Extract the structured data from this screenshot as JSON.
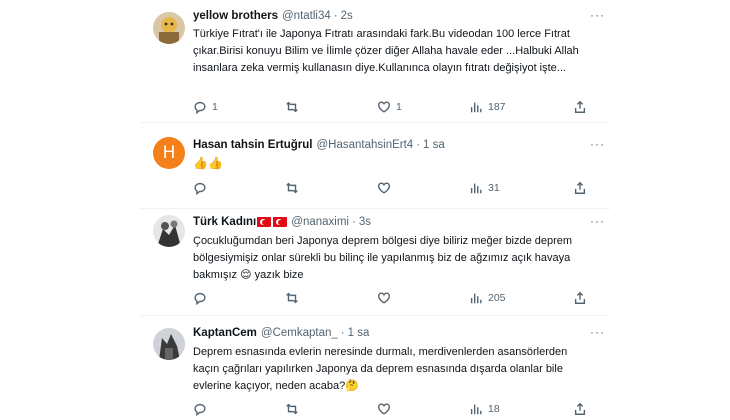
{
  "tweets": [
    {
      "name": "yellow brothers",
      "handle": "@ntatli34",
      "time": "2s",
      "text": "Türkiye Fıtrat'ı ile Japonya Fıtratı arasındaki fark.Bu videodan 100 lerce Fıtrat çıkar.Birisi konuyu Bilim ve İlimle çözer diğer Allaha havale eder ...Halbuki Allah insanlara zeka vermiş kullanasın diye.Kullanınca olayın fıtratı değişiyot işte...",
      "replies": "1",
      "retweets": "",
      "likes": "1",
      "views": "187"
    },
    {
      "name": "Hasan tahsin Ertuğrul",
      "handle": "@HasantahsinErt4",
      "time": "1 sa",
      "avatar_letter": "H",
      "text": "👍👍",
      "replies": "",
      "retweets": "",
      "likes": "",
      "views": "31"
    },
    {
      "name": "Türk Kadını",
      "handle": "@nanaximi",
      "time": "3s",
      "text": "Çocukluğumdan beri Japonya deprem bölgesi diye biliriz meğer bizde deprem bölgesiymişiz onlar sürekli bu bilinç ile yapılanmış biz de ağzımız açık havaya bakmışız 😌 yazık bize",
      "replies": "",
      "retweets": "",
      "likes": "",
      "views": "205"
    },
    {
      "name": "KaptanCem",
      "handle": "@Cemkaptan_",
      "time": "1 sa",
      "text": "Deprem esnasında evlerin neresinde durmalı, merdivenlerden asansörlerden kaçın çağrıları yapılırken Japonya da deprem esnasında dışarda olanlar bile evlerine kaçıyor, neden acaba?🤔",
      "replies": "",
      "retweets": "",
      "likes": "",
      "views": "18"
    }
  ],
  "ui": {
    "more_glyph": "···",
    "dot": "·"
  },
  "colors": {
    "text": "#0f1419",
    "muted": "#536471",
    "divider": "#eff3f4",
    "avatar_h": "#f4801a"
  }
}
